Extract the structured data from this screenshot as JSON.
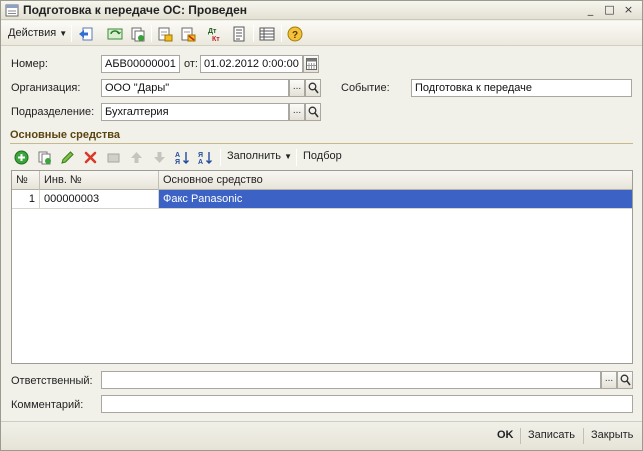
{
  "window": {
    "title": "Подготовка к передаче ОС: Проведен",
    "controls": [
      "_",
      "□",
      "×"
    ]
  },
  "toolbar": {
    "actions_label": "Действия",
    "icons": [
      "go-back-icon",
      "refresh-icon",
      "copy-icon",
      "post-document-icon",
      "unpost-document-icon",
      "dt-kt-icon",
      "print-icon",
      "structure-icon",
      "help-icon"
    ],
    "dt_text": "Дт",
    "kt_text": "Кт"
  },
  "form": {
    "number_label": "Номер:",
    "number_value": "АБВ00000001",
    "date_label": "от:",
    "date_value": "01.02.2012  0:00:00",
    "org_label": "Организация:",
    "org_value": "ООО \"Дары\"",
    "event_label": "Событие:",
    "event_value": "Подготовка к передаче",
    "dept_label": "Подразделение:",
    "dept_value": "Бухгалтерия",
    "select_glyph": "..."
  },
  "assets": {
    "section_title": "Основные средства",
    "fill_label": "Заполнить",
    "pick_label": "Подбор",
    "columns": [
      "№",
      "Инв. №",
      "Основное средство"
    ],
    "rows": [
      {
        "n": "1",
        "inv": "000000003",
        "asset": "Факс Panasonic"
      }
    ]
  },
  "bottom": {
    "responsible_label": "Ответственный:",
    "responsible_value": "",
    "comment_label": "Комментарий:",
    "comment_value": ""
  },
  "footer": {
    "ok_label": "OK",
    "save_label": "Записать",
    "close_label": "Закрыть"
  },
  "colors": {
    "selection": "#3c62c6",
    "section_title": "#5a4410"
  }
}
